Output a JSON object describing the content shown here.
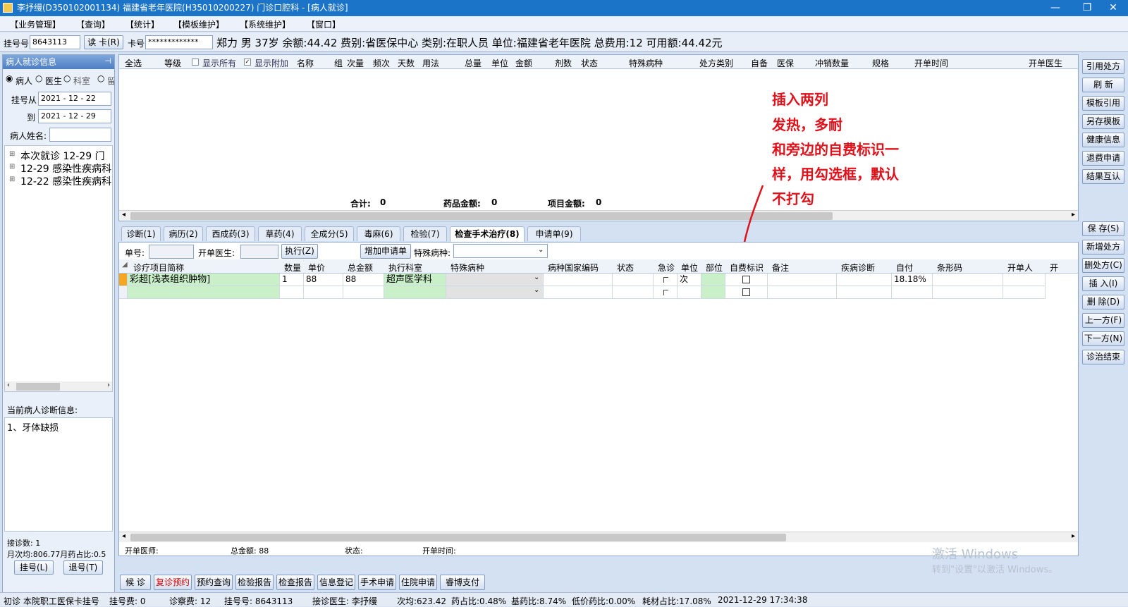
{
  "window": {
    "title": "李抒缦(D350102001134) 福建省老年医院(H35010200227) 门诊口腔科 - [病人就诊]",
    "minimize": "—",
    "restore": "❐",
    "close": "✕"
  },
  "menu": [
    "【业务管理】",
    "【查询】",
    "【统计】",
    "【模板维护】",
    "【系统维护】",
    "【窗口】"
  ],
  "infobar": {
    "reg_label": "挂号号",
    "reg_value": "8643113",
    "read_card": "读 卡(R)",
    "card_label": "卡号",
    "card_value": "*************",
    "patient_summary": "郑力  男  37岁  余额:44.42  费别:省医保中心  类别:在职人员  单位:福建省老年医院  总费用:12  可用额:44.42元"
  },
  "left": {
    "title": "病人就诊信息",
    "radios": [
      "病人",
      "医生",
      "科室",
      "留"
    ],
    "reg_from_label": "挂号从",
    "reg_from": "2021 - 12 - 22",
    "reg_to_label": "到",
    "reg_to": "2021 - 12 - 29",
    "name_label": "病人姓名:",
    "tree": [
      "本次就诊 12-29 门",
      "12-29 感染性疾病科",
      "12-22 感染性疾病科"
    ],
    "diag_title": "当前病人诊断信息:",
    "diag_text": "1、牙体缺损",
    "visit_count": "接诊数: 1",
    "month_stats": "月次均:806.77月药占比:0.5",
    "reg_btn": "挂号(L)",
    "unreg_btn": "退号(T)"
  },
  "rx_table": {
    "headers": [
      "全选",
      "等级",
      "显示所有",
      "显示附加",
      "名称",
      "组",
      "次量",
      "频次",
      "天数",
      "用法",
      "总量",
      "单位",
      "金额",
      "剂数",
      "状态",
      "特殊病种",
      "处方类别",
      "自备",
      "医保",
      "冲销数量",
      "规格",
      "开单时间",
      "开单医生"
    ],
    "total_label": "合计:",
    "total_value": "0",
    "drug_label": "药品金额:",
    "drug_value": "0",
    "item_label": "项目金额:",
    "item_value": "0"
  },
  "annotation": [
    "插入两列",
    "发热，多耐",
    "和旁边的自费标识一",
    "样，用勾选框，默认",
    "不打勾"
  ],
  "tabs": [
    "诊断(1)",
    "病历(2)",
    "西成药(3)",
    "草药(4)",
    "全成分(5)",
    "毒麻(6)",
    "检验(7)",
    "检查手术治疗(8)",
    "申请单(9)"
  ],
  "active_tab": "检查手术治疗(8)",
  "form": {
    "order_label": "单号:",
    "doctor_label": "开单医生:",
    "exec_btn": "执行(Z)",
    "add_req_btn": "增加申请单",
    "special_label": "特殊病种:"
  },
  "exam_table": {
    "headers": [
      "诊疗项目简称",
      "数量",
      "单价",
      "总金额",
      "执行科室",
      "特殊病种",
      "病种国家编码",
      "状态",
      "急诊",
      "单位",
      "部位",
      "自费标识",
      "备注",
      "疾病诊断",
      "自付",
      "条形码",
      "开单人",
      "开"
    ],
    "rows": [
      {
        "name": "彩超[浅表组织肿物]",
        "qty": "1",
        "price": "88",
        "total": "88",
        "dept": "超声医学科",
        "unit": "次",
        "selfpay_pct": "18.18%"
      },
      {
        "name": "",
        "qty": "",
        "price": "",
        "total": "",
        "dept": "",
        "unit": "",
        "selfpay_pct": ""
      }
    ]
  },
  "footer_info": {
    "doctor": "开单医师:",
    "total": "总金额: 88",
    "status": "状态:",
    "time": "开单时间:"
  },
  "bottom_buttons": [
    "候 诊",
    "复诊预约",
    "预约查询",
    "检验报告",
    "检查报告",
    "信息登记",
    "手术申请",
    "住院申请",
    "睿博支付"
  ],
  "right_top_buttons": [
    "引用处方",
    "刷 新",
    "模板引用",
    "另存模板",
    "健康信息",
    "退费申请",
    "结果互认"
  ],
  "right_bottom_buttons": [
    "保 存(S)",
    "新增处方",
    "删处方(C)",
    "插 入(I)",
    "删 除(D)",
    "上一方(F)",
    "下一方(N)",
    "诊治结束"
  ],
  "watermark": [
    "激活 Windows",
    "转到\"设置\"以激活 Windows。"
  ],
  "status_bar": [
    "初诊 本院职工医保卡挂号",
    "挂号费:  0",
    "诊察费: 12",
    "挂号号:  8643113",
    "接诊医生:  李抒缦",
    "次均:623.42",
    "药占比:0.48%",
    "基药比:8.74%",
    "低价药比:0.00%",
    "耗材占比:17.08%",
    "2021-12-29 17:34:38"
  ],
  "colors": {
    "title": "#1c74c9",
    "green_cell": "#c9f0c9",
    "annotation": "#e0111a",
    "selected_tab": "#ffffff"
  }
}
